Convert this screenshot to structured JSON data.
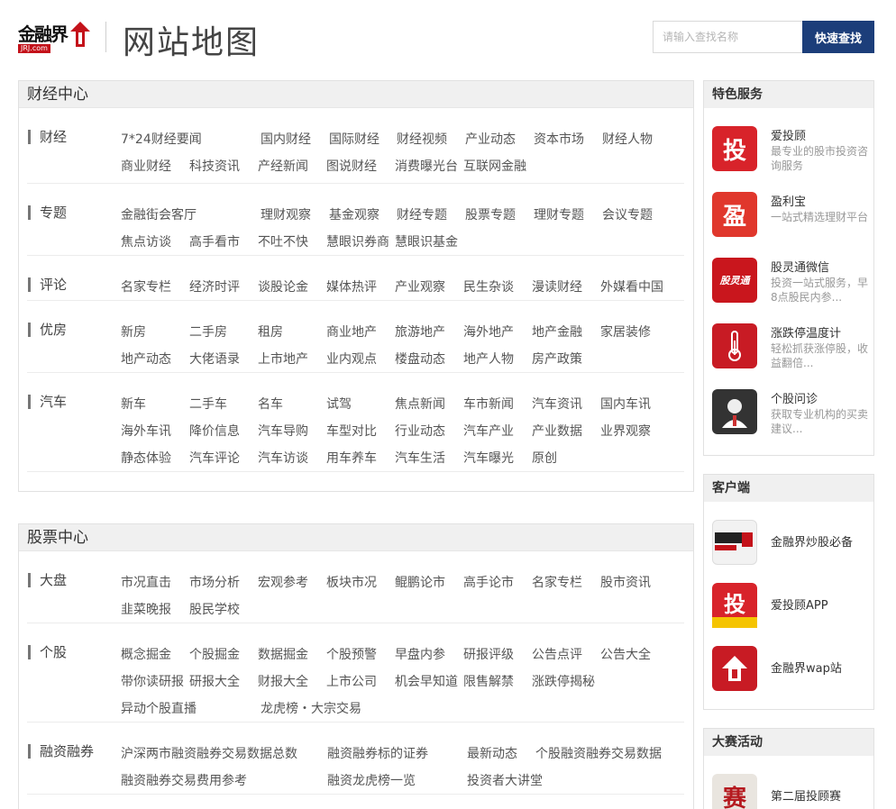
{
  "header": {
    "logo_text": "金融界",
    "logo_url": "JRJ.com",
    "page_title": "网站地图",
    "search_placeholder": "请输入查找名称",
    "search_button": "快速查找"
  },
  "finance_center": {
    "title": "财经中心",
    "rows": [
      {
        "label": "财经",
        "links": [
          "7*24财经要闻",
          "国内财经",
          "国际财经",
          "财经视频",
          "产业动态",
          "资本市场",
          "财经人物",
          "商业财经",
          "科技资讯",
          "产经新闻",
          "图说财经",
          "消费曝光台",
          "互联网金融"
        ]
      },
      {
        "label": "专题",
        "links": [
          "金融街会客厅",
          "理财观察",
          "基金观察",
          "财经专题",
          "股票专题",
          "理财专题",
          "会议专题",
          "焦点访谈",
          "高手看市",
          "不吐不快",
          "慧眼识券商",
          "慧眼识基金"
        ]
      },
      {
        "label": "评论",
        "links": [
          "名家专栏",
          "经济时评",
          "谈股论金",
          "媒体热评",
          "产业观察",
          "民生杂谈",
          "漫读财经",
          "外媒看中国"
        ]
      },
      {
        "label": "优房",
        "links": [
          "新房",
          "二手房",
          "租房",
          "商业地产",
          "旅游地产",
          "海外地产",
          "地产金融",
          "家居装修",
          "地产动态",
          "大佬语录",
          "上市地产",
          "业内观点",
          "楼盘动态",
          "地产人物",
          "房产政策"
        ]
      },
      {
        "label": "汽车",
        "links": [
          "新车",
          "二手车",
          "名车",
          "试驾",
          "焦点新闻",
          "车市新闻",
          "汽车资讯",
          "国内车讯",
          "海外车讯",
          "降价信息",
          "汽车导购",
          "车型对比",
          "行业动态",
          "汽车产业",
          "产业数据",
          "业界观察",
          "静态体验",
          "汽车评论",
          "汽车访谈",
          "用车养车",
          "汽车生活",
          "汽车曝光",
          "原创"
        ]
      }
    ]
  },
  "stock_center": {
    "title": "股票中心",
    "rows": [
      {
        "label": "大盘",
        "links": [
          "市况直击",
          "市场分析",
          "宏观参考",
          "板块市况",
          "鲲鹏论市",
          "高手论市",
          "名家专栏",
          "股市资讯",
          "韭菜晚报",
          "股民学校"
        ]
      },
      {
        "label": "个股",
        "links": [
          "概念掘金",
          "个股掘金",
          "数据掘金",
          "个股预警",
          "早盘内参",
          "研报评级",
          "公告点评",
          "公告大全",
          "带你读研报",
          "研报大全",
          "财报大全",
          "上市公司",
          "机会早知道",
          "限售解禁",
          "涨跌停揭秘",
          "异动个股直播",
          "龙虎榜・大宗交易"
        ]
      },
      {
        "label": "融资融券",
        "links": [
          "沪深两市融资融券交易数据总数",
          "融资融券标的证券",
          "最新动态",
          "个股融资融券交易数据",
          "融资融券交易费用参考",
          "融资龙虎榜一览",
          "投资者大讲堂"
        ]
      }
    ]
  },
  "special_services": {
    "title": "特色服务",
    "items": [
      {
        "name": "爱投顾",
        "desc": "最专业的股市投资咨询服务",
        "icon": "ai-tougu-icon",
        "glyph": "投",
        "color": "#d8232a"
      },
      {
        "name": "盈利宝",
        "desc": "一站式精选理财平台",
        "icon": "yinglibao-icon",
        "glyph": "盈",
        "color": "#e0372c"
      },
      {
        "name": "股灵通微信",
        "desc": "投资一站式服务，早8点股民内参...",
        "icon": "gulingtong-icon",
        "glyph": "股灵通",
        "color": "#c9161d"
      },
      {
        "name": "涨跌停温度计",
        "desc": "轻松抓获涨停股，收益翻倍...",
        "icon": "thermometer-icon",
        "glyph": "🌡",
        "color": "#c81b24"
      },
      {
        "name": "个股问诊",
        "desc": "获取专业机构的买卖建议...",
        "icon": "doctor-icon",
        "glyph": "",
        "color": "#333333"
      }
    ]
  },
  "client": {
    "title": "客户端",
    "items": [
      {
        "name": "金融界炒股必备",
        "icon": "jrj-app-icon"
      },
      {
        "name": "爱投顾APP",
        "icon": "ai-tougu-app-icon"
      },
      {
        "name": "金融界wap站",
        "icon": "jrj-wap-icon"
      }
    ]
  },
  "contest": {
    "title": "大赛活动",
    "items": [
      {
        "name": "第二届投顾赛",
        "icon": "contest-icon",
        "glyph": "赛"
      }
    ]
  },
  "colors": {
    "accent": "#1c3e7a",
    "brand_red": "#c4121a"
  }
}
